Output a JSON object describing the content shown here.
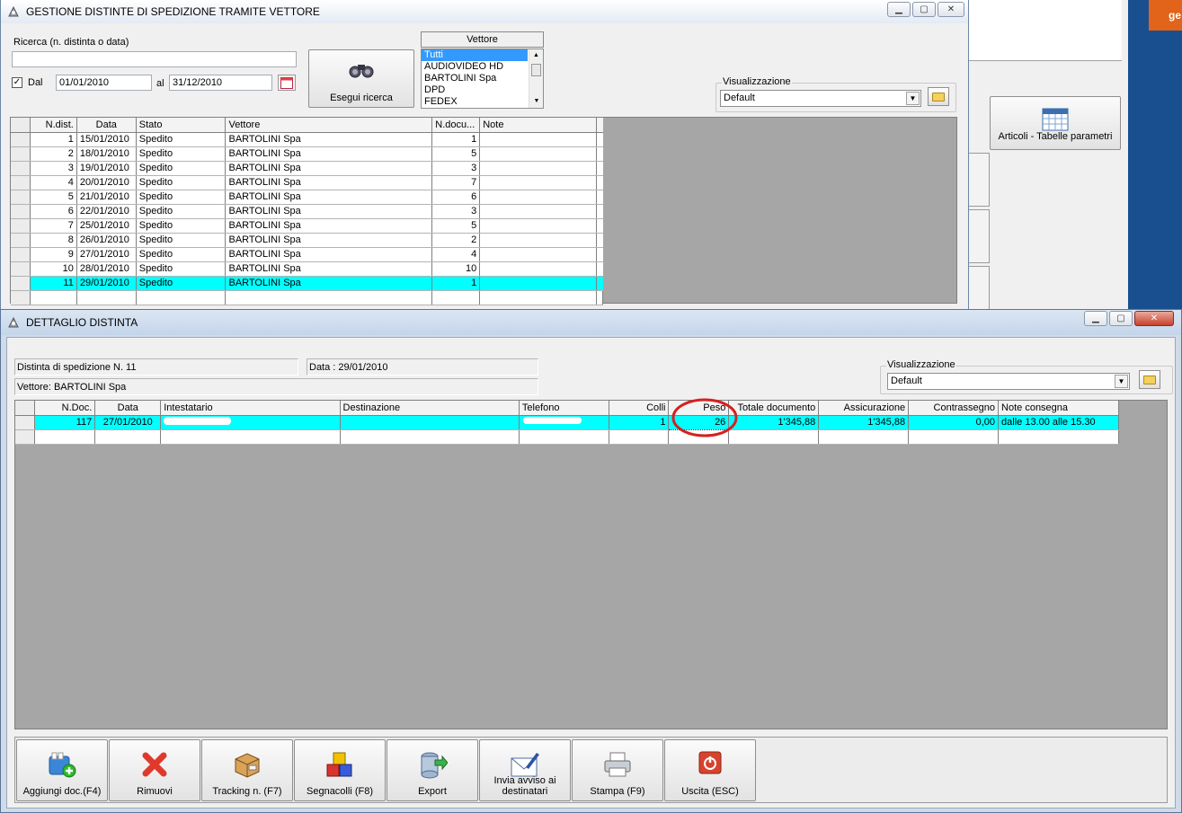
{
  "bg_window": {
    "articoli_button": "Articoli - Tabelle parametri",
    "corner_label": "ge"
  },
  "main": {
    "title": "GESTIONE DISTINTE DI SPEDIZIONE TRAMITE VETTORE",
    "search_label": "Ricerca (n. distinta o data)",
    "search_value": "",
    "dal_label": "Dal",
    "date_from": "01/01/2010",
    "al_label": "al",
    "date_to": "31/12/2010",
    "search_button": "Esegui ricerca",
    "vettore_header": "Vettore",
    "vettore_options": [
      "Tutti",
      "AUDIOVIDEO HD",
      "BARTOLINI Spa",
      "DPD",
      "FEDEX"
    ],
    "visual_label": "Visualizzazione",
    "visual_value": "Default",
    "columns": [
      "N.dist.",
      "Data",
      "Stato",
      "Vettore",
      "N.docu...",
      "Note"
    ],
    "rows": [
      [
        "1",
        "15/01/2010",
        "Spedito",
        "BARTOLINI Spa",
        "1",
        ""
      ],
      [
        "2",
        "18/01/2010",
        "Spedito",
        "BARTOLINI Spa",
        "5",
        ""
      ],
      [
        "3",
        "19/01/2010",
        "Spedito",
        "BARTOLINI Spa",
        "3",
        ""
      ],
      [
        "4",
        "20/01/2010",
        "Spedito",
        "BARTOLINI Spa",
        "7",
        ""
      ],
      [
        "5",
        "21/01/2010",
        "Spedito",
        "BARTOLINI Spa",
        "6",
        ""
      ],
      [
        "6",
        "22/01/2010",
        "Spedito",
        "BARTOLINI Spa",
        "3",
        ""
      ],
      [
        "7",
        "25/01/2010",
        "Spedito",
        "BARTOLINI Spa",
        "5",
        ""
      ],
      [
        "8",
        "26/01/2010",
        "Spedito",
        "BARTOLINI Spa",
        "2",
        ""
      ],
      [
        "9",
        "27/01/2010",
        "Spedito",
        "BARTOLINI Spa",
        "4",
        ""
      ],
      [
        "10",
        "28/01/2010",
        "Spedito",
        "BARTOLINI Spa",
        "10",
        ""
      ],
      [
        "11",
        "29/01/2010",
        "Spedito",
        "BARTOLINI Spa",
        "1",
        ""
      ]
    ]
  },
  "detail": {
    "title": "DETTAGLIO DISTINTA",
    "distinta_label": "Distinta di spedizione N. 11",
    "data_label": "Data : 29/01/2010",
    "vettore_label": "Vettore: BARTOLINI Spa",
    "visual_label": "Visualizzazione",
    "visual_value": "Default",
    "columns": [
      "N.Doc.",
      "Data",
      "Intestatario",
      "Destinazione",
      "Telefono",
      "Colli",
      "Peso",
      "Totale documento",
      "Assicurazione",
      "Contrassegno",
      "Note consegna"
    ],
    "rows": [
      [
        "117",
        "27/01/2010",
        "",
        "",
        "",
        "1",
        "26",
        "1'345,88",
        "1'345,88",
        "0,00",
        "dalle 13.00 alle 15.30"
      ]
    ],
    "buttons": [
      {
        "label": "Aggiungi doc.(F4)",
        "icon": "add-document-icon"
      },
      {
        "label": "Rimuovi",
        "icon": "red-x-icon"
      },
      {
        "label": "Tracking n. (F7)",
        "icon": "package-icon"
      },
      {
        "label": "Segnacolli (F8)",
        "icon": "cubes-icon"
      },
      {
        "label": "Export",
        "icon": "database-export-icon"
      },
      {
        "label": "Invia avviso ai destinatari",
        "icon": "envelope-icon"
      },
      {
        "label": "Stampa (F9)",
        "icon": "printer-icon"
      },
      {
        "label": "Uscita (ESC)",
        "icon": "power-icon"
      }
    ]
  },
  "colors": {
    "selection": "#00ffff",
    "annotation": "#d62020",
    "list_highlight": "#3399ff"
  }
}
